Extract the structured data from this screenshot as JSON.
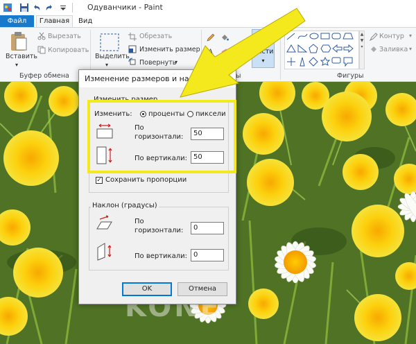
{
  "window": {
    "title": "Одуванчики - Paint"
  },
  "tabs": {
    "file": "Файл",
    "home": "Главная",
    "view": "Вид"
  },
  "ribbon": {
    "clipboard": {
      "paste": "Вставить",
      "cut": "Вырезать",
      "copy": "Копировать",
      "group_label": "Буфер обмена"
    },
    "image": {
      "select": "Выделить",
      "crop": "Обрезать",
      "resize": "Изменить размер",
      "rotate": "Повернуть"
    },
    "tools": {
      "brushes": "Кисти"
    },
    "shapes": {
      "outline": "Контур",
      "fill": "Заливка",
      "group_label": "Фигуры"
    }
  },
  "dialog": {
    "title": "Изменение размеров и накло...",
    "close": "×",
    "resize_section": {
      "legend": "Изменить размер",
      "by_label": "Изменить:",
      "option_percent": "проценты",
      "option_pixels": "пиксели",
      "selected": "percent",
      "horizontal_label_1": "По",
      "horizontal_label_2": "горизонтали:",
      "horizontal_value": "50",
      "vertical_label": "По вертикали:",
      "vertical_value": "50",
      "keep_ratio": "Сохранить пропорции",
      "keep_ratio_checked": true
    },
    "skew_section": {
      "legend": "Наклон (градусы)",
      "horizontal_label_1": "По",
      "horizontal_label_2": "горизонтали:",
      "horizontal_value": "0",
      "vertical_label": "По вертикали:",
      "vertical_value": "0"
    },
    "ok": "OK",
    "cancel": "Отмена"
  },
  "annotation": {
    "arrow_color": "#f4e91d",
    "highlight_color": "#f4e91d"
  },
  "colors": {
    "file_tab": "#1979ca",
    "ribbon_bg": "#f5f6f7",
    "dialog_bg": "#f0f0f0",
    "default_button_border": "#0078d7"
  }
}
